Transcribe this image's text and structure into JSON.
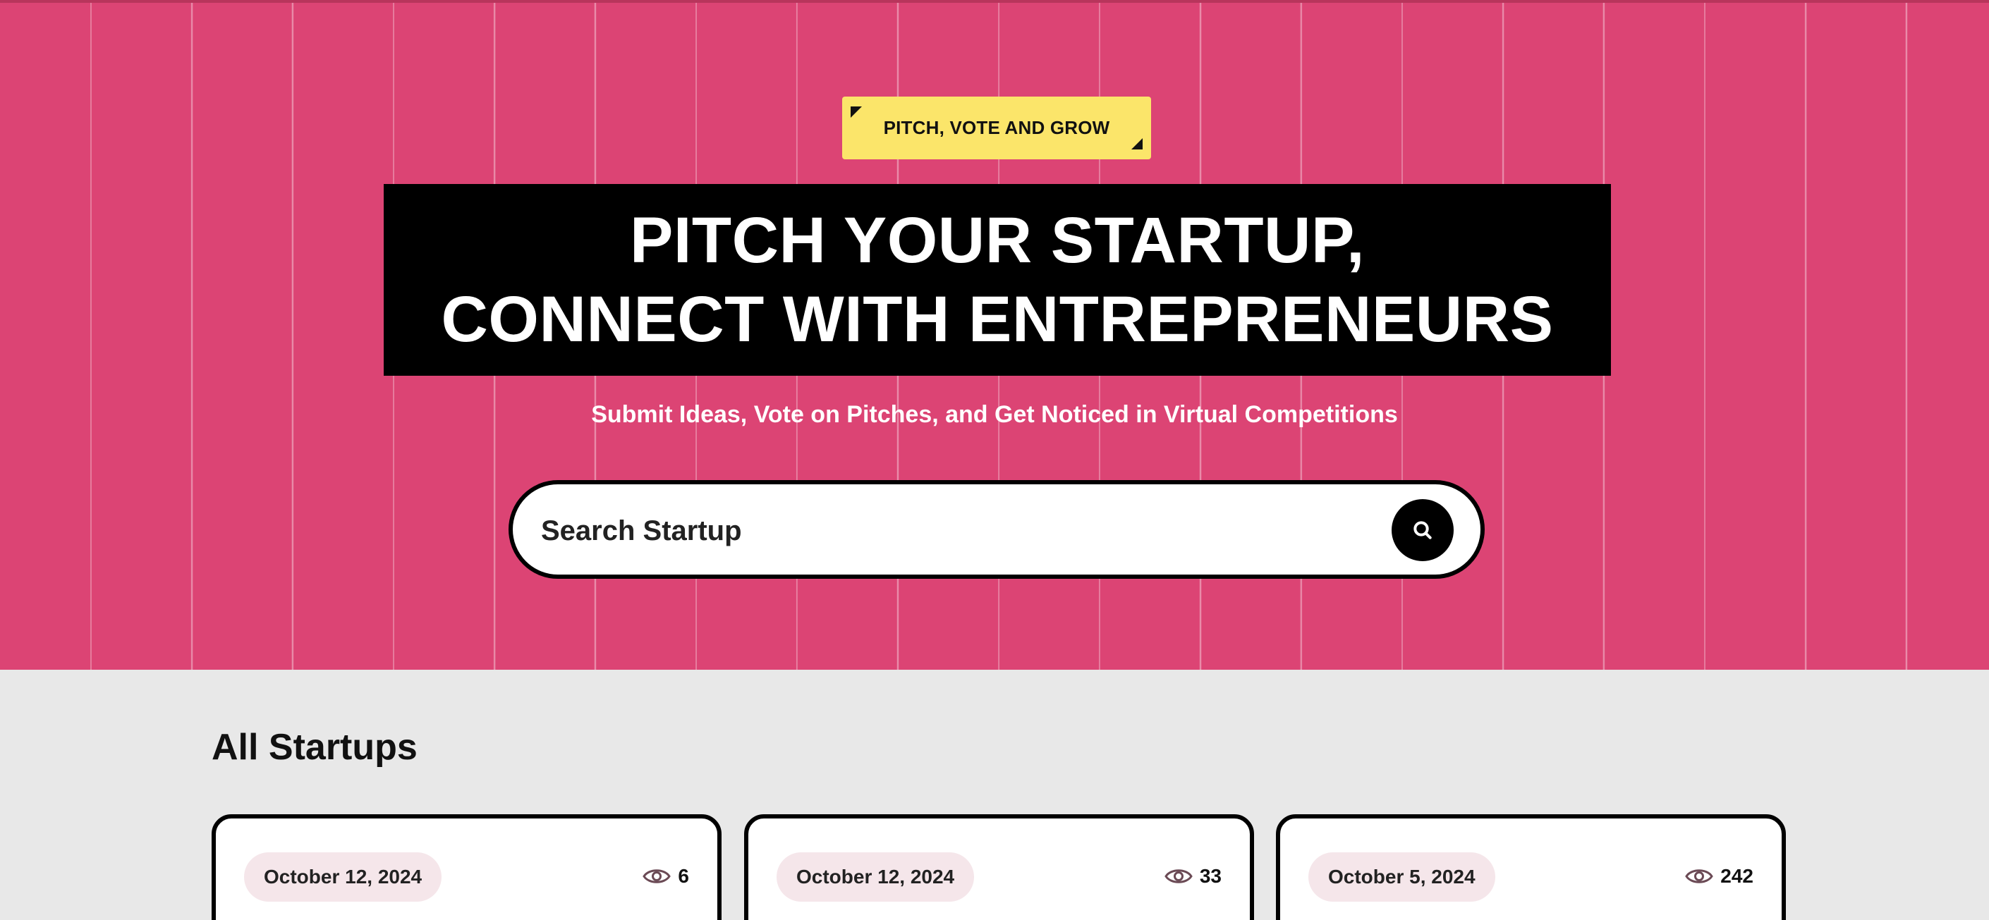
{
  "hero": {
    "tag_label": "PITCH, VOTE AND GROW",
    "headline_line1": "PITCH YOUR STARTUP,",
    "headline_line2": "CONNECT WITH ENTREPRENEURS",
    "subtitle": "Submit Ideas, Vote on Pitches, and Get Noticed in Virtual Competitions",
    "background_color": "#dc4474",
    "tag_color": "#fbe56a"
  },
  "search": {
    "placeholder": "Search Startup",
    "value": "",
    "button_icon": "search-icon"
  },
  "startups": {
    "section_title": "All Startups",
    "cards": [
      {
        "date": "October 12, 2024",
        "views": "6",
        "views_icon": "eye-icon"
      },
      {
        "date": "October 12, 2024",
        "views": "33",
        "views_icon": "eye-icon"
      },
      {
        "date": "October 5, 2024",
        "views": "242",
        "views_icon": "eye-icon"
      }
    ]
  }
}
